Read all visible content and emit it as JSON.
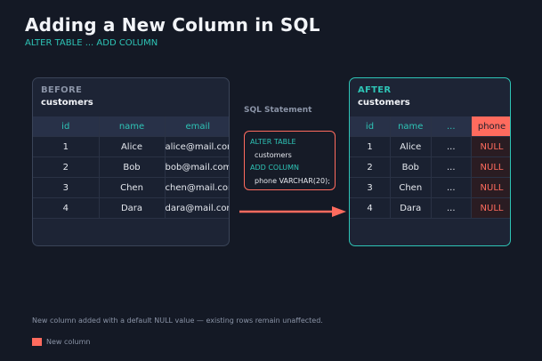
{
  "header": {
    "title": "Adding a New Column in SQL",
    "subtitle": "ALTER TABLE ... ADD COLUMN"
  },
  "before": {
    "label": "BEFORE",
    "table_name": "customers",
    "columns": [
      "id",
      "name",
      "email"
    ],
    "rows": [
      [
        "1",
        "Alice",
        "alice@mail.com"
      ],
      [
        "2",
        "Bob",
        "bob@mail.com"
      ],
      [
        "3",
        "Chen",
        "chen@mail.com"
      ],
      [
        "4",
        "Dara",
        "dara@mail.com"
      ]
    ]
  },
  "sql": {
    "heading": "SQL Statement",
    "lines": [
      "ALTER TABLE",
      "customers",
      "ADD COLUMN",
      "phone VARCHAR(20);"
    ]
  },
  "after": {
    "label": "AFTER",
    "table_name": "customers",
    "columns": [
      "id",
      "name",
      "...",
      "phone"
    ],
    "rows": [
      [
        "1",
        "Alice",
        "...",
        "NULL"
      ],
      [
        "2",
        "Bob",
        "...",
        "NULL"
      ],
      [
        "3",
        "Chen",
        "...",
        "NULL"
      ],
      [
        "4",
        "Dara",
        "...",
        "NULL"
      ]
    ]
  },
  "footnote": "New column added with a default NULL value — existing rows remain unaffected.",
  "legend": {
    "label": "New column"
  },
  "colors": {
    "accent": "#2ec4b6",
    "new_column": "#ff6b5e",
    "background": "#141925"
  },
  "icons": {
    "arrow": "arrow-right-icon"
  }
}
